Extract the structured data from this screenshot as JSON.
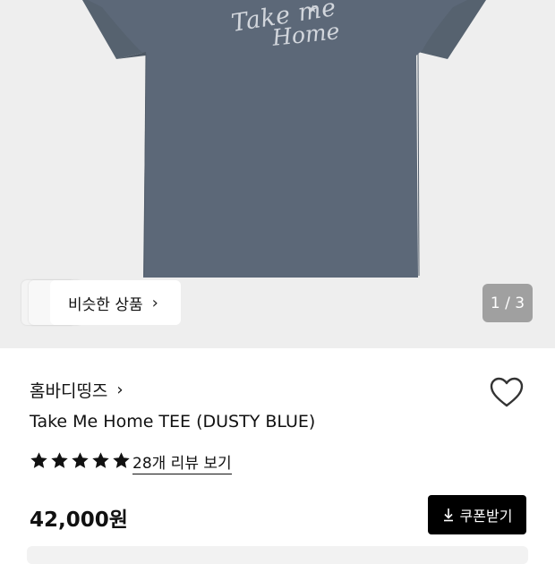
{
  "gallery": {
    "print_line1": "Take me",
    "print_line2": "Home",
    "similar_label": "비슷한 상품",
    "counter": "1 / 3"
  },
  "product": {
    "brand": "홈바디띵즈",
    "title": "Take Me Home TEE (DUSTY BLUE)",
    "rating_stars": 5,
    "review_link": "28개 리뷰 보기",
    "price": "42,000원",
    "coupon_label": "쿠폰받기"
  },
  "icons": {
    "wishlist": "heart-outline-icon",
    "star": "star-icon",
    "chevron": "chevron-right-icon",
    "download": "download-icon"
  },
  "colors": {
    "tee": "#5c6878",
    "gallery_bg": "#eeeeee",
    "accent": "#000000"
  }
}
